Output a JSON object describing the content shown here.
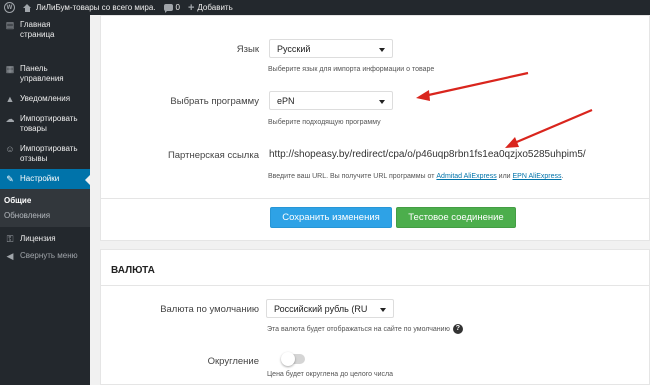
{
  "adminbar": {
    "site_name": "ЛиЛиБум-товары со всего мира.",
    "comments_count": "0",
    "add_label": "Добавить"
  },
  "sidebar": {
    "items": [
      {
        "label": "Главная страница",
        "icon": "dashboard-icon"
      },
      {
        "label": "Панель управления",
        "icon": "panel-icon"
      },
      {
        "label": "Уведомления",
        "icon": "notifications-icon"
      },
      {
        "label": "Импортировать товары",
        "icon": "cloud-upload-icon"
      },
      {
        "label": "Импортировать отзывы",
        "icon": "reviews-icon"
      },
      {
        "label": "Настройки",
        "icon": "wrench-icon"
      }
    ],
    "submenu": [
      "Общие",
      "Обновления"
    ],
    "license_label": "Лицензия",
    "collapse_label": "Свернуть меню"
  },
  "settings": {
    "language": {
      "label": "Язык",
      "value": "Русский",
      "hint": "Выберите язык для импорта информации о товаре"
    },
    "program": {
      "label": "Выбрать программу",
      "value": "ePN",
      "hint": "Выберите подходящую программу"
    },
    "partner_link": {
      "label": "Партнерская ссылка",
      "value": "http://shopeasy.by/redirect/cpa/o/p46uqp8rbn1fs1ea0qzjxo5285uhpim5/",
      "hint_prefix": "Введите ваш URL. Вы получите URL программы от",
      "link1": "Admitad AliExpress",
      "hint_mid": "или",
      "link2": "EPN AliExpress",
      "hint_suffix": "."
    },
    "save_button": "Сохранить изменения",
    "test_button": "Тестовое соединение"
  },
  "currency": {
    "title": "ВАЛЮТА",
    "default": {
      "label": "Валюта по умолчанию",
      "value": "Российский рубль (RU",
      "hint": "Эта валюта будет отображаться на сайте по умолчанию"
    },
    "rounding": {
      "label": "Округление",
      "hint": "Цена будет округлена до целого числа",
      "enabled": false
    }
  },
  "colors": {
    "accent": "#0073aa",
    "blue_button": "#2ea2e6",
    "green_button": "#4cae4c",
    "arrow": "#d9251d"
  }
}
